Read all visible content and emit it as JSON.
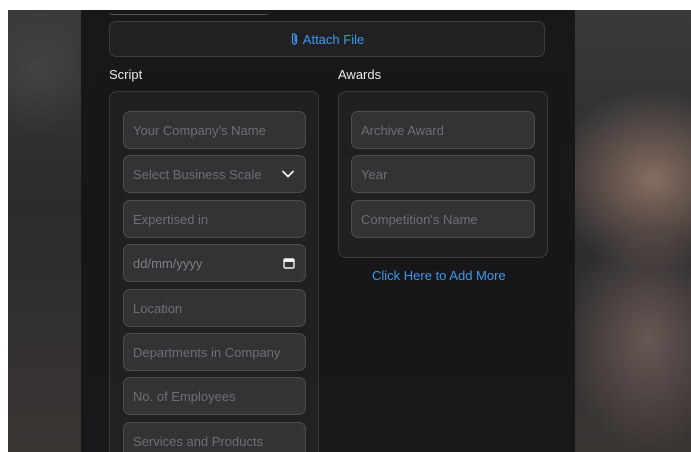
{
  "attach": {
    "label": "Attach File",
    "icon": "paperclip-icon"
  },
  "script": {
    "heading": "Script",
    "fields": {
      "company_name": "Your Company's Name",
      "business_scale": "Select Business Scale",
      "expertised": "Expertised in",
      "date": "dd/mm/yyyy",
      "location": "Location",
      "departments": "Departments in Company",
      "employees": "No. of Employees",
      "services": "Services and Products"
    }
  },
  "awards": {
    "heading": "Awards",
    "fields": {
      "archive_award": "Archive Award",
      "year": "Year",
      "competition": "Competition's Name"
    },
    "add_more_label": "Click Here to Add More"
  },
  "colors": {
    "accent": "#3d97f0",
    "placeholder": "#6e6e74",
    "panel": "#161618"
  }
}
